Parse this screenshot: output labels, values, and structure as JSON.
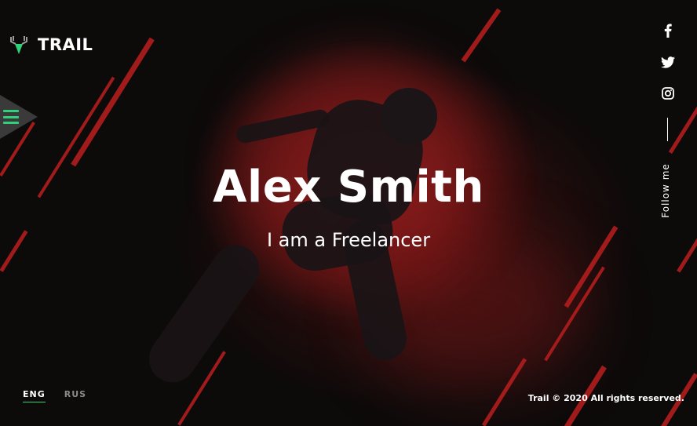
{
  "brand": {
    "name": "TRAIL",
    "logo_icon": "deer-antler-icon",
    "accent": "#2fd17a"
  },
  "menu": {
    "icon": "hamburger-icon"
  },
  "hero": {
    "title": "Alex Smith",
    "subtitle_prefix": "I am a",
    "subtitle_role": "Freelancer"
  },
  "social": {
    "items": [
      {
        "name": "facebook",
        "icon": "facebook-icon"
      },
      {
        "name": "twitter",
        "icon": "twitter-icon"
      },
      {
        "name": "instagram",
        "icon": "instagram-icon"
      }
    ],
    "follow_label": "Follow me"
  },
  "languages": {
    "options": [
      "ENG",
      "RUS"
    ],
    "selected": "ENG"
  },
  "footer": {
    "copyright": "Trail © 2020 All rights reserved."
  },
  "colors": {
    "background": "#0d0a0a",
    "stripe": "#b11d1d",
    "accent": "#2fd17a"
  }
}
